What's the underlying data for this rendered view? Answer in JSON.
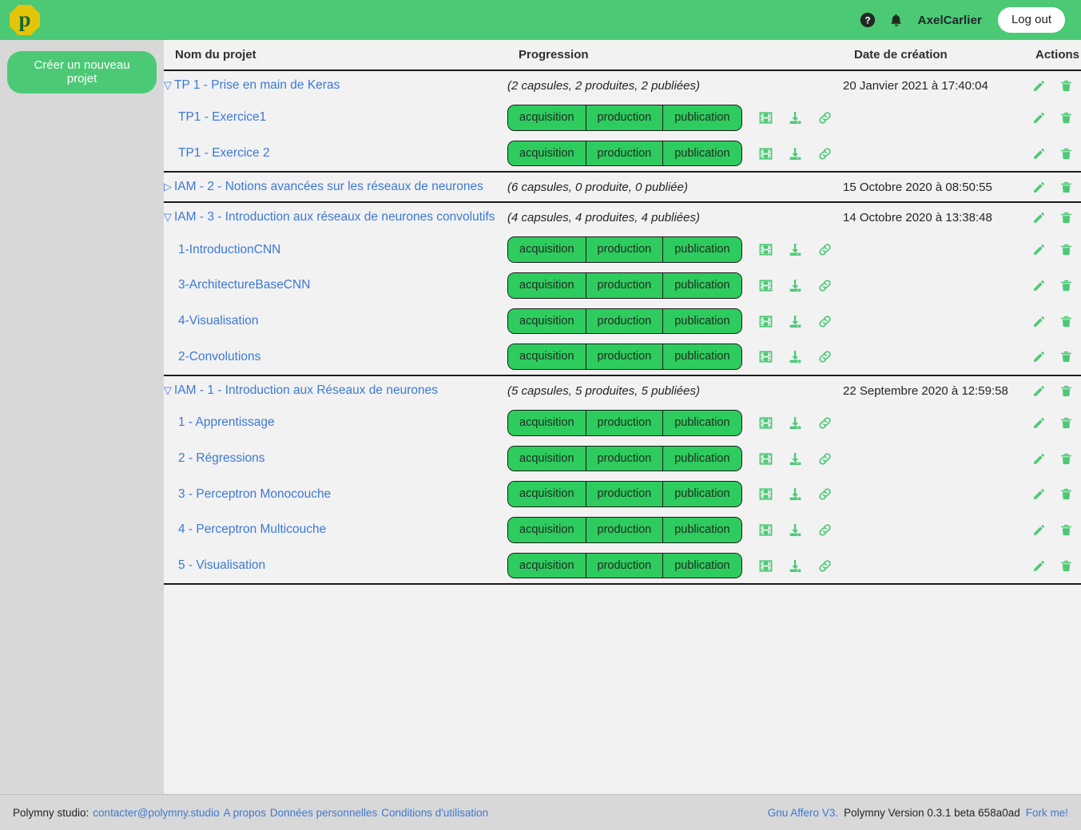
{
  "header": {
    "logo_letter": "p",
    "help_icon": "help-circle-icon",
    "bell_icon": "bell-icon",
    "username": "AxelCarlier",
    "logout_label": "Log out"
  },
  "sidebar": {
    "new_project_label": "Créer un nouveau projet"
  },
  "table": {
    "columns": {
      "name": "Nom du projet",
      "progression": "Progression",
      "date": "Date de création",
      "actions": "Actions"
    }
  },
  "badges": {
    "acquisition": "acquisition",
    "production": "production",
    "publication": "publication"
  },
  "icons": {
    "film": "film-icon",
    "download": "download-icon",
    "link": "link-icon",
    "edit": "pencil-icon",
    "delete": "trash-icon",
    "expanded": "▽",
    "collapsed": "▷"
  },
  "colors": {
    "header_green": "#4bc975",
    "badge_green": "#2ecc5e",
    "icon_green": "#4bc975",
    "link_blue": "#3d79d4",
    "sidebar_gray": "#d8d8d8",
    "main_bg": "#f2f2f2",
    "logo_yellow": "#e3c50a",
    "logo_letter_green": "#15683a"
  },
  "projects": [
    {
      "id": "tp1",
      "expanded": true,
      "toggle": "▽",
      "name": "TP 1 - Prise en main de Keras",
      "progress_note": "(2 capsules, 2 produites, 2 publiées)",
      "date": "20 Janvier 2021 à 17:40:04",
      "capsules": [
        {
          "name": "TP1 - Exercice1"
        },
        {
          "name": "TP1 - Exercice 2"
        }
      ]
    },
    {
      "id": "iam2",
      "expanded": false,
      "toggle": "▷",
      "name": "IAM - 2 - Notions avancées sur les réseaux de neurones",
      "progress_note": "(6 capsules, 0 produite, 0 publiée)",
      "date": "15 Octobre 2020 à 08:50:55",
      "capsules": []
    },
    {
      "id": "iam3",
      "expanded": true,
      "toggle": "▽",
      "name": "IAM - 3 - Introduction aux réseaux de neurones convolutifs",
      "progress_note": "(4 capsules, 4 produites, 4 publiées)",
      "date": "14 Octobre 2020 à 13:38:48",
      "capsules": [
        {
          "name": "1-IntroductionCNN"
        },
        {
          "name": "3-ArchitectureBaseCNN"
        },
        {
          "name": "4-Visualisation"
        },
        {
          "name": "2-Convolutions"
        }
      ]
    },
    {
      "id": "iam1",
      "expanded": true,
      "toggle": "▽",
      "name": "IAM - 1 - Introduction aux Réseaux de neurones",
      "progress_note": "(5 capsules, 5 produites, 5 publiées)",
      "date": "22 Septembre 2020 à 12:59:58",
      "capsules": [
        {
          "name": "1 - Apprentissage"
        },
        {
          "name": "2 - Régressions"
        },
        {
          "name": "3 - Perceptron Monocouche"
        },
        {
          "name": "4 - Perceptron Multicouche"
        },
        {
          "name": "5 - Visualisation"
        }
      ]
    }
  ],
  "footer": {
    "label": "Polymny studio:",
    "contact": "contacter@polymny.studio",
    "about": "A propos",
    "personal_data": "Données personnelles",
    "terms": "Conditions d'utilisation",
    "license": "Gnu Affero V3.",
    "version": "Polymny Version 0.3.1 beta 658a0ad",
    "fork": "Fork me!"
  }
}
